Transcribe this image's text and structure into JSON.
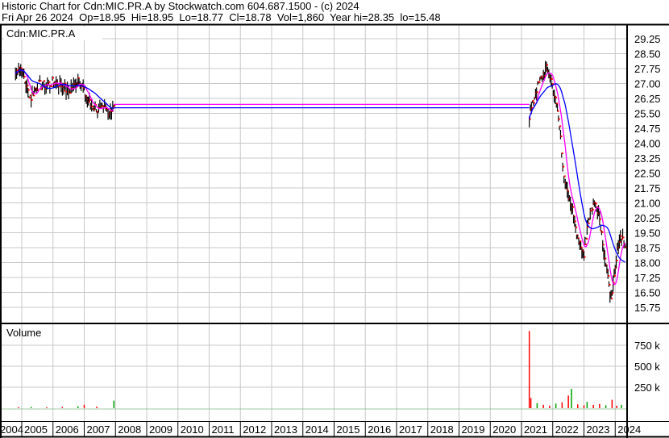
{
  "header": {
    "line1": "Historic Chart for Cdn:MIC.PR.A by Stockwatch.com 604.687.1500 - (c) 2024",
    "line2": "Fri Apr 26 2024  Op=18.95  Hi=18.95  Lo=18.77  Cl=18.78  Vol=1,860  Year hi=28.35  lo=15.48"
  },
  "chart_data": {
    "type": "line",
    "title": "Cdn:MIC.PR.A",
    "volume_label": "Volume",
    "price_ticks": [
      "29.25",
      "28.50",
      "27.75",
      "27.00",
      "26.25",
      "25.50",
      "24.75",
      "24.00",
      "23.25",
      "22.50",
      "21.75",
      "21.00",
      "20.25",
      "19.50",
      "18.75",
      "18.00",
      "17.25",
      "16.50",
      "15.75"
    ],
    "ylim": [
      15.75,
      29.25
    ],
    "volume_ticks": [
      {
        "label": "750 k",
        "v": 750000
      },
      {
        "label": "500 k",
        "v": 500000
      },
      {
        "label": "250 k",
        "v": 250000
      }
    ],
    "years": [
      "2004",
      "2005",
      "2006",
      "2007",
      "2008",
      "2009",
      "2010",
      "2011",
      "2012",
      "2013",
      "2014",
      "2015",
      "2016",
      "2017",
      "2018",
      "2019",
      "2020",
      "2021",
      "2022",
      "2023",
      "2024"
    ],
    "segments": [
      [
        [
          2004.8,
          27.5
        ],
        [
          2004.9,
          27.9
        ],
        [
          2005.0,
          27.7
        ],
        [
          2005.1,
          27.1
        ],
        [
          2005.2,
          26.6
        ],
        [
          2005.3,
          26.3
        ],
        [
          2005.4,
          26.7
        ],
        [
          2005.5,
          26.9
        ],
        [
          2005.7,
          26.9
        ],
        [
          2005.9,
          27.0
        ],
        [
          2006.1,
          27.1
        ],
        [
          2006.3,
          26.9
        ],
        [
          2006.5,
          26.6
        ],
        [
          2006.7,
          26.9
        ],
        [
          2006.8,
          27.3
        ],
        [
          2006.9,
          26.9
        ],
        [
          2007.0,
          26.6
        ],
        [
          2007.1,
          26.2
        ],
        [
          2007.2,
          25.9
        ],
        [
          2007.35,
          25.8
        ],
        [
          2007.5,
          25.6
        ],
        [
          2007.65,
          25.7
        ],
        [
          2007.8,
          25.6
        ],
        [
          2007.95,
          25.9
        ]
      ],
      [
        [
          2021.25,
          25.4
        ],
        [
          2021.35,
          25.9
        ],
        [
          2021.45,
          26.6
        ],
        [
          2021.55,
          27.0
        ],
        [
          2021.7,
          27.5
        ],
        [
          2021.8,
          27.7
        ],
        [
          2021.95,
          27.2
        ],
        [
          2022.05,
          26.4
        ],
        [
          2022.15,
          25.6
        ],
        [
          2022.25,
          24.4
        ],
        [
          2022.32,
          23.0
        ],
        [
          2022.4,
          21.8
        ],
        [
          2022.5,
          21.2
        ],
        [
          2022.6,
          20.8
        ],
        [
          2022.7,
          20.2
        ],
        [
          2022.8,
          19.3
        ],
        [
          2022.9,
          18.6
        ],
        [
          2023.0,
          18.5
        ],
        [
          2023.1,
          19.8
        ],
        [
          2023.2,
          20.6
        ],
        [
          2023.3,
          20.9
        ],
        [
          2023.4,
          21.0
        ],
        [
          2023.5,
          20.2
        ],
        [
          2023.6,
          19.1
        ],
        [
          2023.7,
          17.9
        ],
        [
          2023.8,
          16.7
        ],
        [
          2023.9,
          16.3
        ],
        [
          2024.0,
          17.6
        ],
        [
          2024.1,
          19.0
        ],
        [
          2024.2,
          19.4
        ],
        [
          2024.32,
          18.78
        ]
      ]
    ],
    "flat": {
      "from": 2007.95,
      "to": 2021.25,
      "ma_short": 25.95,
      "ma_long": 25.78
    },
    "volume": [
      [
        2004.9,
        12000
      ],
      [
        2005.3,
        15000
      ],
      [
        2005.8,
        10000
      ],
      [
        2006.3,
        14000
      ],
      [
        2006.8,
        22000
      ],
      [
        2007.0,
        40000
      ],
      [
        2007.4,
        18000
      ],
      [
        2007.95,
        90000
      ],
      [
        2021.25,
        920000
      ],
      [
        2021.3,
        120000
      ],
      [
        2021.5,
        60000
      ],
      [
        2021.7,
        40000
      ],
      [
        2021.9,
        30000
      ],
      [
        2022.1,
        55000
      ],
      [
        2022.3,
        70000
      ],
      [
        2022.5,
        150000
      ],
      [
        2022.6,
        230000
      ],
      [
        2022.8,
        45000
      ],
      [
        2023.0,
        35000
      ],
      [
        2023.1,
        75000
      ],
      [
        2023.3,
        40000
      ],
      [
        2023.5,
        50000
      ],
      [
        2023.7,
        35000
      ],
      [
        2023.9,
        100000
      ],
      [
        2024.05,
        30000
      ],
      [
        2024.2,
        40000
      ]
    ],
    "colors": {
      "bar": "#000000",
      "close": "#ff0000",
      "ma_short": "#ff00ff",
      "ma_long": "#0000ff",
      "vol_up": "#ff0000",
      "vol_down": "#00a000",
      "grid": "#c8c8c8"
    }
  }
}
